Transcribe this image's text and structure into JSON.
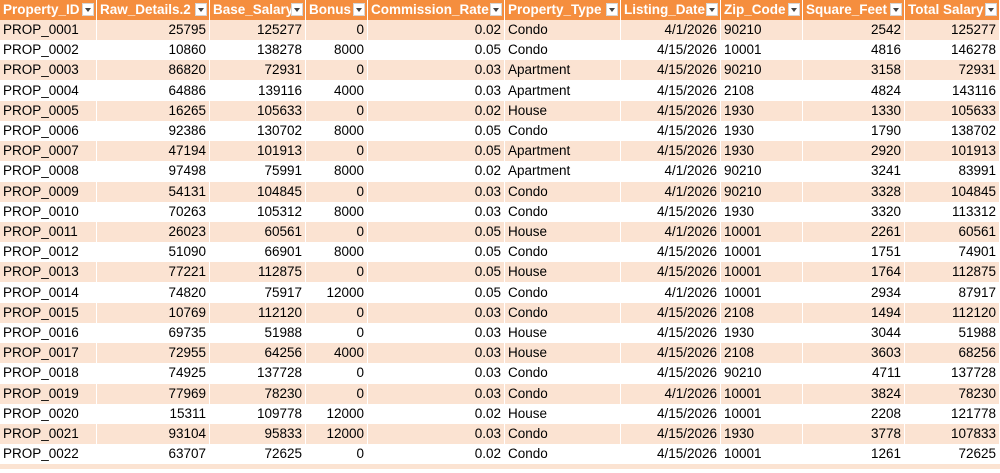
{
  "columns": [
    {
      "key": "id",
      "label": "Property_ID",
      "width": 97,
      "align": "txt"
    },
    {
      "key": "raw",
      "label": "Raw_Details.2",
      "width": 113,
      "align": "num"
    },
    {
      "key": "base",
      "label": "Base_Salary",
      "width": 96,
      "align": "num"
    },
    {
      "key": "bonus",
      "label": "Bonus",
      "width": 62,
      "align": "num"
    },
    {
      "key": "rate",
      "label": "Commission_Rate",
      "width": 137,
      "align": "num"
    },
    {
      "key": "type",
      "label": "Property_Type",
      "width": 116,
      "align": "txt"
    },
    {
      "key": "date",
      "label": "Listing_Date",
      "width": 100,
      "align": "num"
    },
    {
      "key": "zip",
      "label": "Zip_Code",
      "width": 82,
      "align": "txt"
    },
    {
      "key": "sqft",
      "label": "Square_Feet",
      "width": 102,
      "align": "num"
    },
    {
      "key": "total",
      "label": "Total Salary",
      "width": 95,
      "align": "num"
    }
  ],
  "rows": [
    [
      "PROP_0001",
      "25795",
      "125277",
      "0",
      "0.02",
      "Condo",
      "4/1/2026",
      "90210",
      "2542",
      "125277"
    ],
    [
      "PROP_0002",
      "10860",
      "138278",
      "8000",
      "0.05",
      "Condo",
      "4/15/2026",
      "10001",
      "4816",
      "146278"
    ],
    [
      "PROP_0003",
      "86820",
      "72931",
      "0",
      "0.03",
      "Apartment",
      "4/15/2026",
      "90210",
      "3158",
      "72931"
    ],
    [
      "PROP_0004",
      "64886",
      "139116",
      "4000",
      "0.03",
      "Apartment",
      "4/15/2026",
      "2108",
      "4824",
      "143116"
    ],
    [
      "PROP_0005",
      "16265",
      "105633",
      "0",
      "0.02",
      "House",
      "4/15/2026",
      "1930",
      "1330",
      "105633"
    ],
    [
      "PROP_0006",
      "92386",
      "130702",
      "8000",
      "0.05",
      "Condo",
      "4/15/2026",
      "1930",
      "1790",
      "138702"
    ],
    [
      "PROP_0007",
      "47194",
      "101913",
      "0",
      "0.05",
      "Apartment",
      "4/15/2026",
      "1930",
      "2920",
      "101913"
    ],
    [
      "PROP_0008",
      "97498",
      "75991",
      "8000",
      "0.02",
      "Apartment",
      "4/1/2026",
      "90210",
      "3241",
      "83991"
    ],
    [
      "PROP_0009",
      "54131",
      "104845",
      "0",
      "0.03",
      "Condo",
      "4/1/2026",
      "90210",
      "3328",
      "104845"
    ],
    [
      "PROP_0010",
      "70263",
      "105312",
      "8000",
      "0.03",
      "Condo",
      "4/15/2026",
      "1930",
      "3320",
      "113312"
    ],
    [
      "PROP_0011",
      "26023",
      "60561",
      "0",
      "0.05",
      "House",
      "4/1/2026",
      "10001",
      "2261",
      "60561"
    ],
    [
      "PROP_0012",
      "51090",
      "66901",
      "8000",
      "0.05",
      "Condo",
      "4/15/2026",
      "10001",
      "1751",
      "74901"
    ],
    [
      "PROP_0013",
      "77221",
      "112875",
      "0",
      "0.05",
      "House",
      "4/15/2026",
      "10001",
      "1764",
      "112875"
    ],
    [
      "PROP_0014",
      "74820",
      "75917",
      "12000",
      "0.05",
      "Condo",
      "4/1/2026",
      "10001",
      "2934",
      "87917"
    ],
    [
      "PROP_0015",
      "10769",
      "112120",
      "0",
      "0.03",
      "Condo",
      "4/15/2026",
      "2108",
      "1494",
      "112120"
    ],
    [
      "PROP_0016",
      "69735",
      "51988",
      "0",
      "0.03",
      "House",
      "4/15/2026",
      "1930",
      "3044",
      "51988"
    ],
    [
      "PROP_0017",
      "72955",
      "64256",
      "4000",
      "0.03",
      "House",
      "4/15/2026",
      "2108",
      "3603",
      "68256"
    ],
    [
      "PROP_0018",
      "74925",
      "137728",
      "0",
      "0.03",
      "Condo",
      "4/15/2026",
      "90210",
      "4711",
      "137728"
    ],
    [
      "PROP_0019",
      "77969",
      "78230",
      "0",
      "0.03",
      "Condo",
      "4/1/2026",
      "10001",
      "3824",
      "78230"
    ],
    [
      "PROP_0020",
      "15311",
      "109778",
      "12000",
      "0.02",
      "House",
      "4/15/2026",
      "10001",
      "2208",
      "121778"
    ],
    [
      "PROP_0021",
      "93104",
      "95833",
      "12000",
      "0.03",
      "Condo",
      "4/15/2026",
      "1930",
      "3778",
      "107833"
    ],
    [
      "PROP_0022",
      "63707",
      "72625",
      "0",
      "0.02",
      "Condo",
      "4/15/2026",
      "10001",
      "1261",
      "72625"
    ]
  ],
  "colors": {
    "header_bg": "#f58e3e",
    "header_text": "#ffffff",
    "band_bg": "#fbe3d2",
    "plain_bg": "#ffffff"
  },
  "icons": {
    "filter": "filter-dropdown-icon"
  }
}
